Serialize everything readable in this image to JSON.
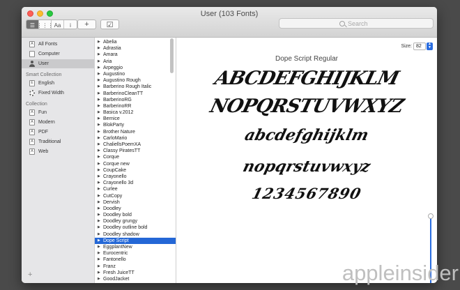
{
  "window": {
    "title": "User (103 Fonts)"
  },
  "toolbar": {
    "view_buttons": [
      "☰",
      "⋮⋮⋮",
      "Aa",
      "i"
    ],
    "add_label": "+",
    "check_label": "☑",
    "search_placeholder": "Search"
  },
  "sidebar": {
    "library_items": [
      {
        "label": "All Fonts",
        "icon": "A"
      },
      {
        "label": "Computer",
        "icon": ""
      },
      {
        "label": "User",
        "icon": "user"
      }
    ],
    "smart_header": "Smart Collection",
    "smart_items": [
      {
        "label": "English",
        "icon": "E"
      },
      {
        "label": "Fixed Width",
        "icon": "gear"
      }
    ],
    "collection_header": "Collection",
    "collection_items": [
      {
        "label": "Fun",
        "icon": "A"
      },
      {
        "label": "Modern",
        "icon": "A"
      },
      {
        "label": "PDF",
        "icon": "A"
      },
      {
        "label": "Traditional",
        "icon": "A"
      },
      {
        "label": "Web",
        "icon": "A"
      }
    ],
    "add_label": "+"
  },
  "fonts": [
    "Abelia",
    "Adrastia",
    "Amara",
    "Aria",
    "Arpeggio",
    "Augustino",
    "Augustino Rough",
    "Barberino Rough Italic",
    "BarberinoCleanTT",
    "BarberinoRG",
    "BarberinoRR",
    "Basica v.2012",
    "Bernice",
    "BlokParty",
    "Brother Nature",
    "CarloMario",
    "ChaliellsPoemXA",
    "Classy PiratesTT",
    "Corque",
    "Corque new",
    "CoupCake",
    "Crayonello",
    "Crayonello 3d",
    "Curlee",
    "CutCopy",
    "Dervish",
    "Doodley",
    "Doodley bold",
    "Doodley grungy",
    "Doodley outline bold",
    "Doodley shadow",
    "Dope Script",
    "EggplantNew",
    "Eurocentric",
    "Fantonello",
    "Franz",
    "Fresh JuiceTT",
    "GoodJacket"
  ],
  "selected_font": "Dope Script",
  "preview": {
    "size_label": "Size:",
    "size_value": "82",
    "font_name": "Dope Script Regular",
    "lines": [
      "ABCDEFGHIJKLM",
      "NOPQRSTUVWXYZ",
      "abcdefghijklm",
      "nopqrstuvwxyz",
      "1234567890"
    ]
  },
  "watermark": "appleinsider"
}
